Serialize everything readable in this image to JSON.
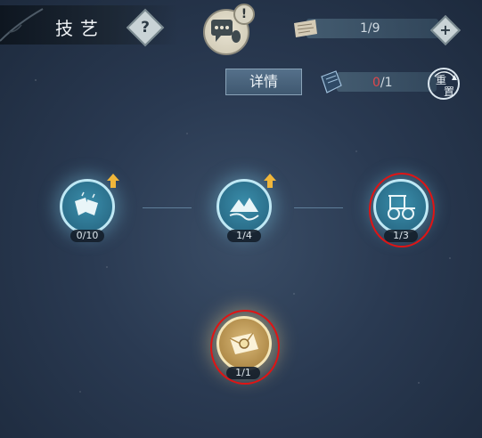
{
  "header": {
    "title": "技艺",
    "help_icon": "question-mark-icon",
    "help_symbol": "?"
  },
  "chat": {
    "icon": "chat-bubble-icon",
    "alert": "!"
  },
  "resources": {
    "scroll": {
      "icon": "scroll-icon",
      "value": "1/9",
      "add_symbol": "+"
    },
    "book": {
      "icon": "book-icon",
      "current": "0",
      "total": "/1",
      "current_color": "#e0474c"
    }
  },
  "detail_button": "详情",
  "reset_button": {
    "top": "重",
    "bottom": "置"
  },
  "skill_nodes": [
    {
      "id": "node-1",
      "icon": "lanterns-icon",
      "progress": "0/10",
      "has_upgrade": true
    },
    {
      "id": "node-2",
      "icon": "mountain-river-icon",
      "progress": "1/4",
      "has_upgrade": true
    },
    {
      "id": "node-3",
      "icon": "carriage-icon",
      "progress": "1/3",
      "highlighted": true
    },
    {
      "id": "node-4",
      "icon": "envelope-seal-icon",
      "progress": "1/1",
      "highlighted": true,
      "unlocked": true
    }
  ],
  "colors": {
    "highlight_ring": "#e01414",
    "accent_gold": "#d9b979",
    "node_blue": "#2b6f8b"
  }
}
